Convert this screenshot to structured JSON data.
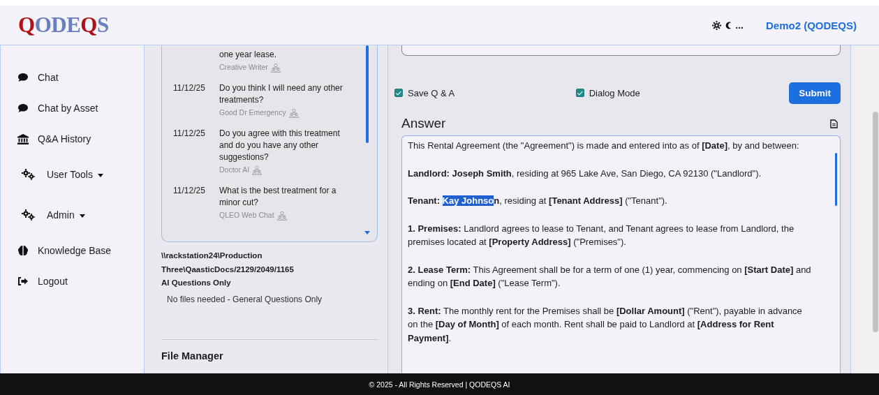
{
  "header": {
    "logo": "QODEQS",
    "theme_more": "...",
    "user": "Demo2 (QODEQS)"
  },
  "sidebar": {
    "items": [
      {
        "label": "Chat",
        "kind": "chat",
        "dropdown": false
      },
      {
        "label": "Chat by Asset",
        "kind": "chat",
        "dropdown": false
      },
      {
        "label": "Q&A History",
        "kind": "history",
        "dropdown": false
      },
      {
        "label": "User Tools",
        "kind": "tools",
        "dropdown": true
      },
      {
        "label": "Admin",
        "kind": "tools",
        "dropdown": true
      },
      {
        "label": "Knowledge Base",
        "kind": "knowledge",
        "dropdown": false
      },
      {
        "label": "Logout",
        "kind": "logout",
        "dropdown": false
      }
    ]
  },
  "history": [
    {
      "question": "one year lease.",
      "assistant": "Creative Writer"
    },
    {
      "date": "11/12/25",
      "question": "Do you think I will need any other treatments?",
      "assistant": "Good Dr Emergency"
    },
    {
      "date": "11/12/25",
      "question": "Do you agree with this treatment and do you have any other suggestions?",
      "assistant": "Doctor AI"
    },
    {
      "date": "11/12/25",
      "question": "What is the best treatment for a minor cut?",
      "assistant": "QLEO Web Chat"
    }
  ],
  "source": {
    "path": "\\\\rackstation24\\Production Three\\QaasticDocs/2129/2049/1165",
    "mode": "AI Questions Only",
    "note": "No files needed - General Questions Only"
  },
  "file_manager": {
    "title": "File Manager"
  },
  "options": [
    {
      "label": "Save Q & A",
      "checked": true
    },
    {
      "label": "Dialog Mode",
      "checked": true
    }
  ],
  "submit": "Submit",
  "answer": {
    "title": "Answer",
    "paragraphs": [
      [
        {
          "text": "This Rental Agreement (the \"Agreement\") is made and entered into as of **[Date]**, by and between:",
          "selected": false
        }
      ],
      [
        {
          "text": "**Landlord: Joseph Smith**, residing at 965 Lake Ave, San Diego, CA 92130 (\"Landlord\").",
          "selected": false
        }
      ],
      [
        {
          "text": "**Tenant:** ",
          "selected": false
        },
        {
          "text": "**Kay Johnso**",
          "selected": true
        },
        {
          "text": "**n**, residing at **[Tenant Address]** (\"Tenant\").",
          "selected": false
        }
      ],
      [
        {
          "text": "**1. Premises:** Landlord agrees to lease to Tenant, and Tenant agrees to lease from Landlord, the premises located at **[Property Address]** (\"Premises\").",
          "selected": false
        }
      ],
      [
        {
          "text": "**2. Lease Term:** This Agreement shall be for a term of one (1) year, commencing on **[Start Date]** and ending on **[End Date]** (\"Lease Term\").",
          "selected": false
        }
      ],
      [
        {
          "text": "**3. Rent:** The monthly rent for the Premises shall be **[Dollar Amount]** (\"Rent\"), payable in advance on the **[Day of Month]** of each month. Rent shall be paid to Landlord at **[Address for Rent Payment]**.",
          "selected": false
        }
      ]
    ]
  },
  "footer": "© 2025 - All Rights Reserved | QODEQS AI"
}
